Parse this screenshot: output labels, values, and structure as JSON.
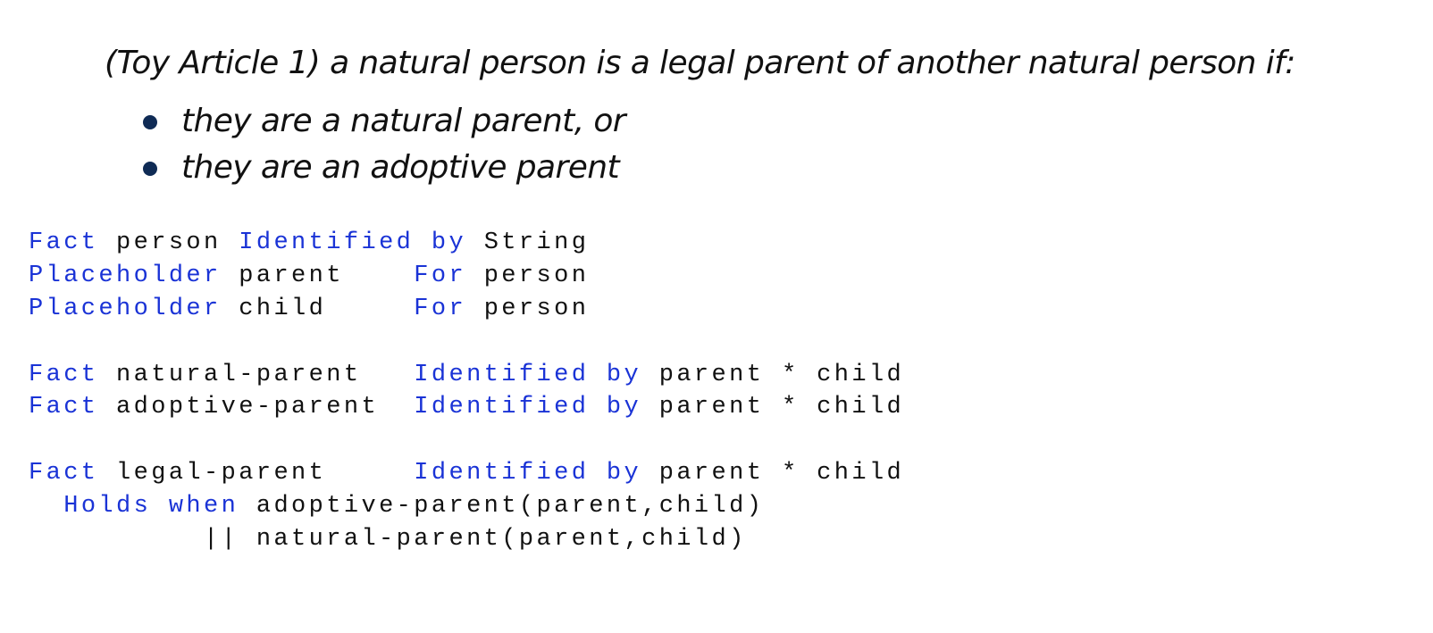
{
  "heading": "(Toy Article 1) a natural person is a legal parent of another natural person if:",
  "bullets": [
    "they are a natural parent, or",
    "they are an adoptive parent"
  ],
  "colors": {
    "keyword": "#1a33d6",
    "text": "#111111",
    "bullet": "#0f2b55"
  },
  "code": {
    "lines": [
      [
        {
          "t": "Fact",
          "kw": true
        },
        {
          "t": " person "
        },
        {
          "t": "Identified by",
          "kw": true
        },
        {
          "t": " String"
        }
      ],
      [
        {
          "t": "Placeholder",
          "kw": true
        },
        {
          "t": " parent    "
        },
        {
          "t": "For",
          "kw": true
        },
        {
          "t": " person"
        }
      ],
      [
        {
          "t": "Placeholder",
          "kw": true
        },
        {
          "t": " child     "
        },
        {
          "t": "For",
          "kw": true
        },
        {
          "t": " person"
        }
      ],
      [],
      [
        {
          "t": "Fact",
          "kw": true
        },
        {
          "t": " natural-parent   "
        },
        {
          "t": "Identified by",
          "kw": true
        },
        {
          "t": " parent * child"
        }
      ],
      [
        {
          "t": "Fact",
          "kw": true
        },
        {
          "t": " adoptive-parent  "
        },
        {
          "t": "Identified by",
          "kw": true
        },
        {
          "t": " parent * child"
        }
      ],
      [],
      [
        {
          "t": "Fact",
          "kw": true
        },
        {
          "t": " legal-parent     "
        },
        {
          "t": "Identified by",
          "kw": true
        },
        {
          "t": " parent * child"
        }
      ],
      [
        {
          "t": "  "
        },
        {
          "t": "Holds when",
          "kw": true
        },
        {
          "t": " adoptive-parent(parent,child)"
        }
      ],
      [
        {
          "t": "          || natural-parent(parent,child)"
        }
      ]
    ]
  }
}
